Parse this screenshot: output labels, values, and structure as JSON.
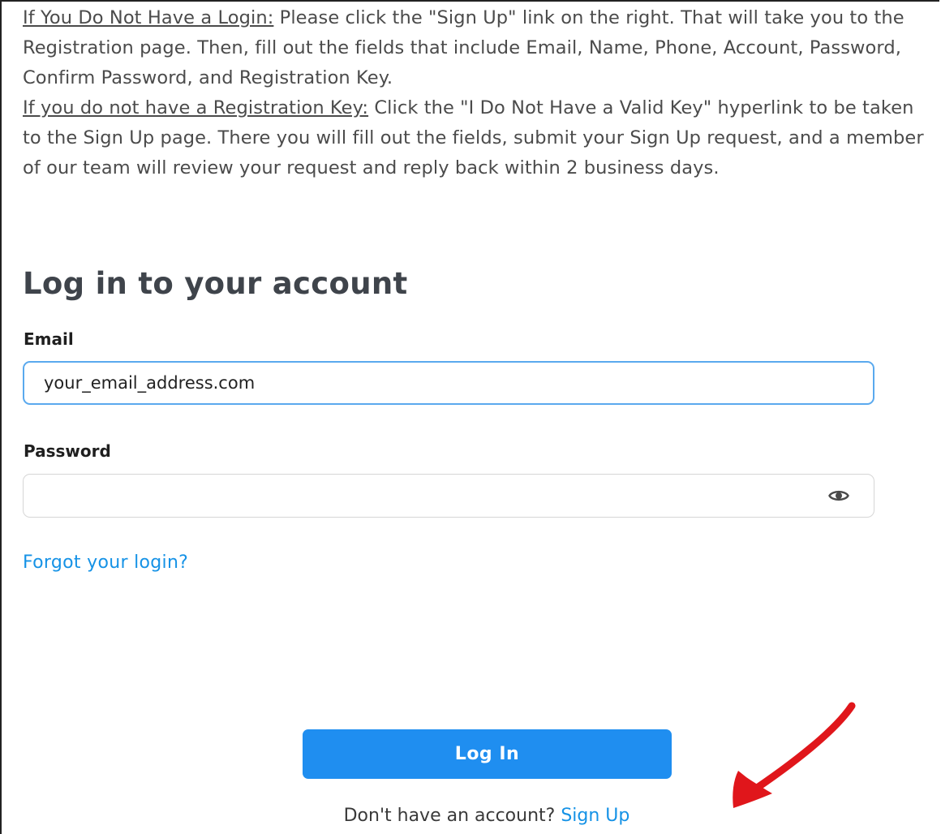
{
  "intro": {
    "no_login_label": "If You Do Not Have a Login:",
    "no_login_text": " Please click the \"Sign Up\" link on the right. That will take you to the Registration page. Then, fill out the fields that include Email, Name, Phone, Account, Password, Confirm Password, and Registration Key.",
    "no_key_label": "If you do not have a Registration Key:",
    "no_key_text": " Click the \"I Do Not Have a Valid Key\" hyperlink to be taken to the Sign Up page. There you will fill out the fields, submit your Sign Up request, and a member of our team will review your request and reply back within 2 business days."
  },
  "login": {
    "heading": "Log in to your account",
    "email_label": "Email",
    "email_value": "your_email_address.com",
    "password_label": "Password",
    "password_value": "",
    "password_toggle_icon": "eye-icon",
    "forgot_link": "Forgot your login?",
    "submit_label": "Log In",
    "signup_prompt": "Don't have an account? ",
    "signup_link": "Sign Up"
  },
  "annotation": {
    "arrow_color": "#e0161b"
  },
  "colors": {
    "accent": "#1f8ef0",
    "link": "#1592e6",
    "focus_border": "#5aa9ee"
  }
}
